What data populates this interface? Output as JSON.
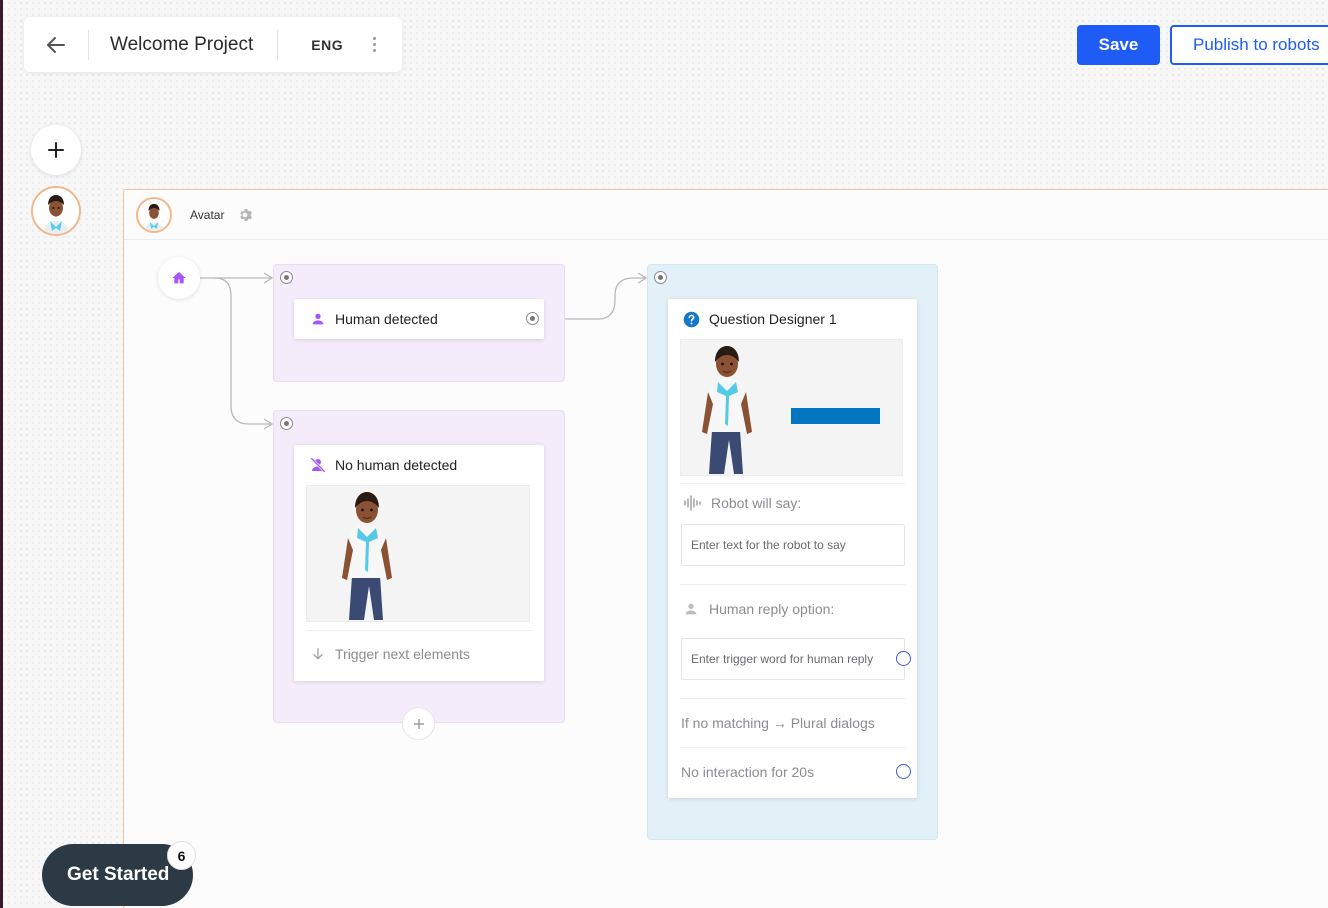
{
  "header": {
    "project_title": "Welcome Project",
    "language": "ENG",
    "save_label": "Save",
    "publish_label": "Publish to robots"
  },
  "flow": {
    "label": "Avatar",
    "nodes": {
      "human_detected": {
        "title": "Human detected"
      },
      "no_human_detected": {
        "title": "No human detected",
        "trigger_label": "Trigger next elements"
      },
      "question_designer": {
        "title": "Question Designer 1",
        "robot_say_label": "Robot will say:",
        "robot_say_placeholder": "Enter text for the robot to say",
        "human_reply_label": "Human reply option:",
        "human_reply_placeholder": "Enter trigger word for human reply",
        "no_match_label": "If no matching → Plural dialogs",
        "no_interaction_label": "No interaction for 20s"
      }
    }
  },
  "get_started": {
    "label": "Get Started",
    "badge": "6"
  },
  "colors": {
    "primary": "#1e5cf5",
    "node_purple": "#a855f7",
    "info_blue": "#1677c9",
    "accent_orange": "#f3b78a"
  },
  "icons": [
    "back-arrow-icon",
    "kebab-menu-icon",
    "plus-icon",
    "avatar-icon",
    "gear-icon",
    "home-icon",
    "person-icon",
    "person-off-icon",
    "question-icon",
    "waveform-icon",
    "arrow-down-icon"
  ]
}
